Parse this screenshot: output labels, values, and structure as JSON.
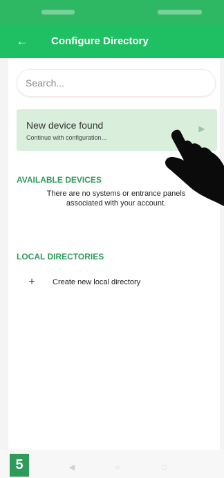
{
  "app_bar": {
    "title": "Configure Directory",
    "back_icon": "arrow-left-icon",
    "color": "#1fbf63"
  },
  "search": {
    "placeholder": "Search..."
  },
  "device_card": {
    "title": "New device found",
    "subtitle": "Continue with configuration...",
    "background": "#d9efdc"
  },
  "available_devices": {
    "header": "AVAILABLE DEVICES",
    "empty_message": "There are no systems or entrance panels associated with your account."
  },
  "local_directories": {
    "header": "LOCAL DIRECTORIES",
    "create_label": "Create new local directory",
    "create_icon": "plus-icon"
  },
  "step_badge": "5",
  "accent_color": "#2e9b5b",
  "nav": [
    "back-nav-icon",
    "home-nav-icon",
    "recents-nav-icon"
  ]
}
